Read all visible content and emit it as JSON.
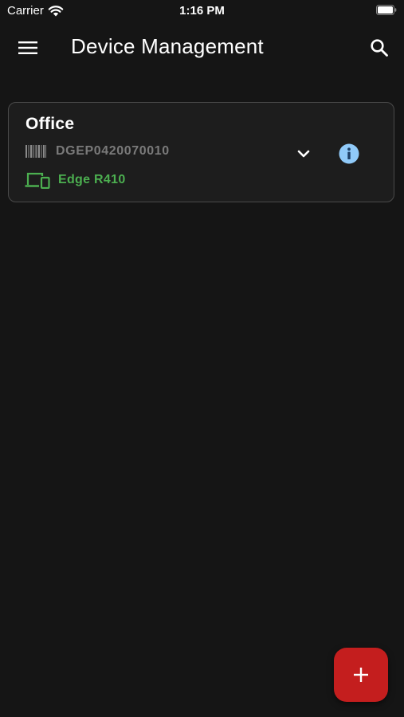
{
  "status_bar": {
    "carrier": "Carrier",
    "time": "1:16 PM",
    "wifi_icon": "wifi-icon",
    "battery_icon": "battery-icon"
  },
  "app_bar": {
    "title": "Device Management",
    "menu_icon": "hamburger-menu-icon",
    "search_icon": "search-icon"
  },
  "devices": [
    {
      "name": "Office",
      "serial": "DGEP0420070010",
      "model": "Edge R410",
      "serial_icon": "barcode-icon",
      "model_icon": "devices-icon",
      "expand_icon": "chevron-down-icon",
      "info_icon": "info-icon"
    }
  ],
  "fab": {
    "icon": "plus-icon"
  },
  "colors": {
    "background": "#151515",
    "card_background": "#1d1d1d",
    "card_border": "#4a4a4a",
    "model_green": "#4caf50",
    "info_blue": "#90caf9",
    "fab_red": "#c41e1e",
    "serial_gray": "#7a7a7a"
  }
}
